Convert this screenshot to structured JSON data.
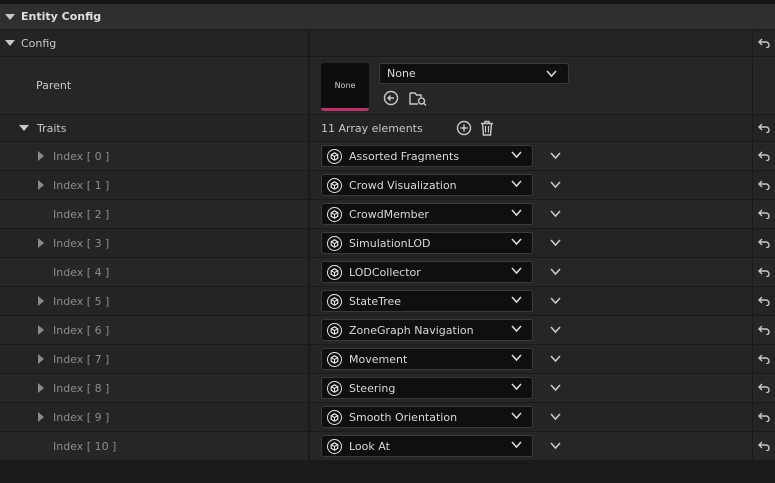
{
  "header": {
    "title": "Entity Config"
  },
  "config": {
    "label": "Config"
  },
  "parent": {
    "label": "Parent",
    "thumbnail_text": "None",
    "value": "None"
  },
  "traits": {
    "label": "Traits",
    "count_text": "11 Array elements",
    "items": [
      {
        "index": "Index [ 0 ]",
        "value": "Assorted Fragments",
        "expandable": true
      },
      {
        "index": "Index [ 1 ]",
        "value": "Crowd Visualization",
        "expandable": true
      },
      {
        "index": "Index [ 2 ]",
        "value": "CrowdMember",
        "expandable": false
      },
      {
        "index": "Index [ 3 ]",
        "value": "SimulationLOD",
        "expandable": true
      },
      {
        "index": "Index [ 4 ]",
        "value": "LODCollector",
        "expandable": false
      },
      {
        "index": "Index [ 5 ]",
        "value": "StateTree",
        "expandable": true
      },
      {
        "index": "Index [ 6 ]",
        "value": "ZoneGraph Navigation",
        "expandable": true
      },
      {
        "index": "Index [ 7 ]",
        "value": "Movement",
        "expandable": true
      },
      {
        "index": "Index [ 8 ]",
        "value": "Steering",
        "expandable": true
      },
      {
        "index": "Index [ 9 ]",
        "value": "Smooth Orientation",
        "expandable": true
      },
      {
        "index": "Index [ 10 ]",
        "value": "Look At",
        "expandable": false
      }
    ]
  },
  "icons": {
    "reset": "reset-arrow-icon",
    "add": "add-circle-icon",
    "delete": "trash-icon",
    "trait": "unreal-logo-icon",
    "browse": "browse-folder-icon",
    "use_selected": "use-selected-icon"
  },
  "colors": {
    "accent": "#c0306a"
  }
}
